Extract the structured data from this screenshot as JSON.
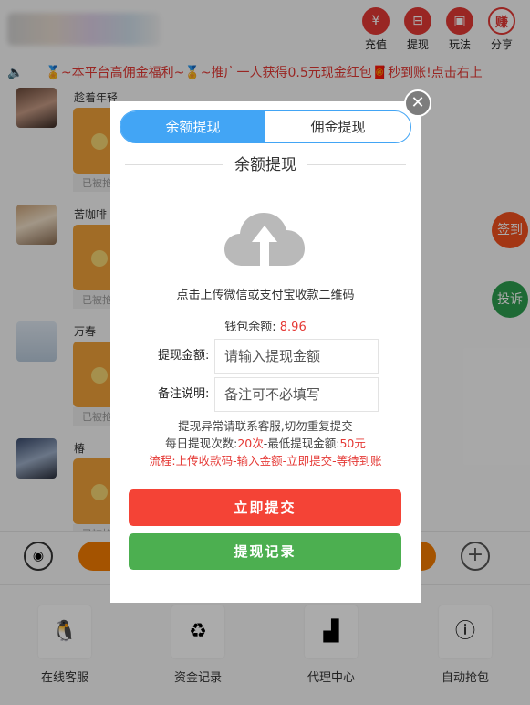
{
  "top_icons": [
    {
      "label": "充值",
      "icon": "yen-icon"
    },
    {
      "label": "提现",
      "icon": "withdraw-icon"
    },
    {
      "label": "玩法",
      "icon": "gift-icon"
    },
    {
      "label": "分享",
      "icon": "earn-icon",
      "glyph": "赚"
    }
  ],
  "marquee": "🏅~本平台高佣金福利~🏅~推广一人获得0.5元现金红包🧧秒到账!点击右上",
  "messages": [
    {
      "nick": "趁着年轻",
      "state": "已被抢"
    },
    {
      "nick": "苦咖啡",
      "state": "已被抢"
    },
    {
      "nick": "万春",
      "state": "已被抢"
    },
    {
      "nick": "椿",
      "state": "已被抢"
    }
  ],
  "side_buttons": {
    "sign_in": "签到",
    "complaint": "投诉"
  },
  "bottom_nav": [
    {
      "label": "在线客服",
      "icon": "penguin-icon"
    },
    {
      "label": "资金记录",
      "icon": "yen-cycle-icon"
    },
    {
      "label": "代理中心",
      "icon": "podium-icon"
    },
    {
      "label": "自动抢包",
      "icon": "info-icon"
    }
  ],
  "modal": {
    "tabs": [
      {
        "label": "余额提现",
        "active": true
      },
      {
        "label": "佣金提现",
        "active": false
      }
    ],
    "section_title": "余额提现",
    "upload_hint": "点击上传微信或支付宝收款二维码",
    "balance_label": "钱包余额:",
    "balance_value": "8.96",
    "amount_label": "提现金额:",
    "amount_placeholder": "请输入提现金额",
    "remark_label": "备注说明:",
    "remark_placeholder": "备注可不必填写",
    "note_line1": "提现异常请联系客服,切勿重复提交",
    "note_line2_prefix": "每日提现次数:",
    "note_line2_count": "20次",
    "note_line2_mid": "-最低提现金额:",
    "note_line2_min": "50元",
    "note_flow": "流程:上传收款码-输入金额-立即提交-等待到账",
    "submit_label": "立即提交",
    "records_label": "提现记录",
    "close_glyph": "✕"
  },
  "colors": {
    "tab_active": "#42a5f5",
    "submit": "#f44336",
    "records": "#4caf50",
    "accent_red": "#e53935"
  }
}
